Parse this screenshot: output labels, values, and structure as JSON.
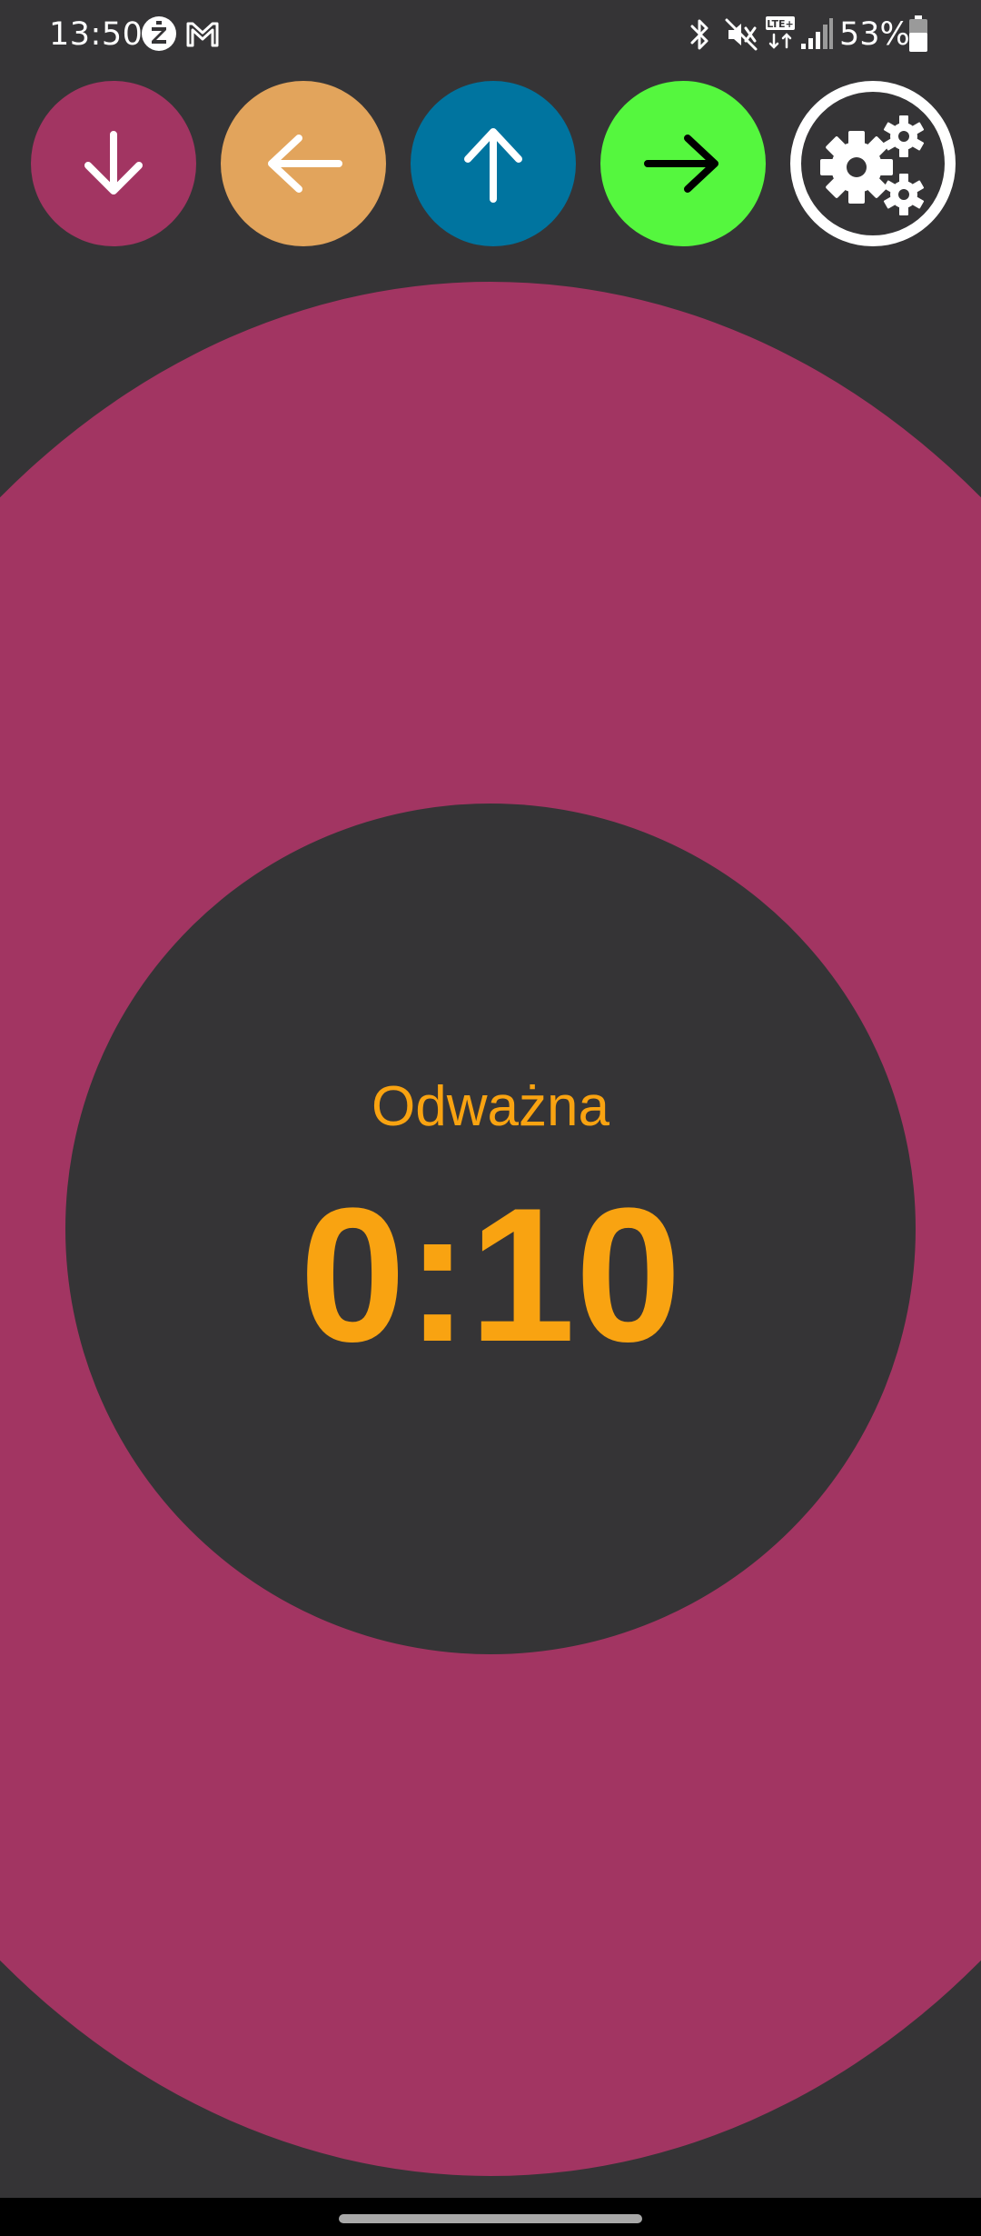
{
  "status_bar": {
    "time": "13:50",
    "battery_percent": "53%",
    "icons": [
      "zabka-app-icon",
      "gmail-icon",
      "bluetooth-icon",
      "vibrate-mute-icon",
      "lte-icon",
      "signal-icon",
      "battery-icon"
    ]
  },
  "toolbar": {
    "buttons": [
      {
        "name": "down",
        "icon": "arrow-down-icon",
        "color": "#a23562"
      },
      {
        "name": "left",
        "icon": "arrow-left-icon",
        "color": "#e2a45c"
      },
      {
        "name": "up",
        "icon": "arrow-up-icon",
        "color": "#00749f"
      },
      {
        "name": "right",
        "icon": "arrow-right-icon",
        "color": "#55f73e"
      },
      {
        "name": "settings",
        "icon": "gears-icon",
        "color": "#ffffff"
      }
    ]
  },
  "dial": {
    "stage_name": "Odważna",
    "timer": "0:10",
    "ring_color": "#a23562",
    "text_color": "#f9a311"
  },
  "colors": {
    "background": "#353436",
    "nav_bar": "#000000"
  }
}
